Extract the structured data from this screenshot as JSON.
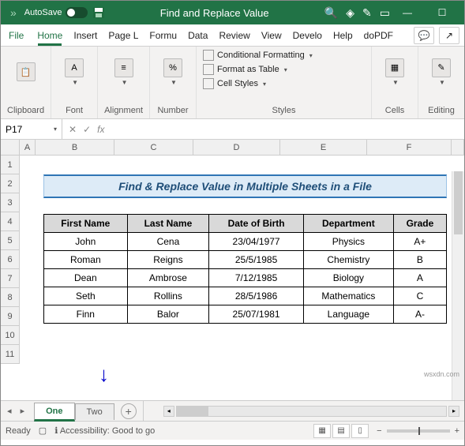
{
  "titlebar": {
    "autosave_label": "AutoSave",
    "doc_title": "Find and Replace Value"
  },
  "menu": {
    "file": "File",
    "tabs": [
      "Home",
      "Insert",
      "Page L",
      "Formu",
      "Data",
      "Review",
      "View",
      "Develo",
      "Help",
      "doPDF"
    ]
  },
  "ribbon": {
    "clipboard": "Clipboard",
    "font": "Font",
    "alignment": "Alignment",
    "number": "Number",
    "cond_fmt": "Conditional Formatting",
    "fmt_table": "Format as Table",
    "cell_styles": "Cell Styles",
    "styles": "Styles",
    "cells": "Cells",
    "editing": "Editing"
  },
  "formula": {
    "namebox": "P17",
    "fx": "fx"
  },
  "cols": [
    "",
    "A",
    "B",
    "C",
    "D",
    "E",
    "F",
    ""
  ],
  "rows": [
    "1",
    "2",
    "3",
    "4",
    "5",
    "6",
    "7",
    "8",
    "9",
    "10",
    "11"
  ],
  "data": {
    "title": "Find & Replace Value in Multiple Sheets in a File",
    "headers": [
      "First Name",
      "Last Name",
      "Date of Birth",
      "Department",
      "Grade"
    ],
    "rows": [
      [
        "John",
        "Cena",
        "23/04/1977",
        "Physics",
        "A+"
      ],
      [
        "Roman",
        "Reigns",
        "25/5/1985",
        "Chemistry",
        "B"
      ],
      [
        "Dean",
        "Ambrose",
        "7/12/1985",
        "Biology",
        "A"
      ],
      [
        "Seth",
        "Rollins",
        "28/5/1986",
        "Mathematics",
        "C"
      ],
      [
        "Finn",
        "Balor",
        "25/07/1981",
        "Language",
        "A-"
      ]
    ]
  },
  "sheets": {
    "tabs": [
      "One",
      "Two"
    ]
  },
  "status": {
    "ready": "Ready",
    "access": "Accessibility: Good to go",
    "zoom": "100%"
  },
  "watermark": "wsxdn.com"
}
